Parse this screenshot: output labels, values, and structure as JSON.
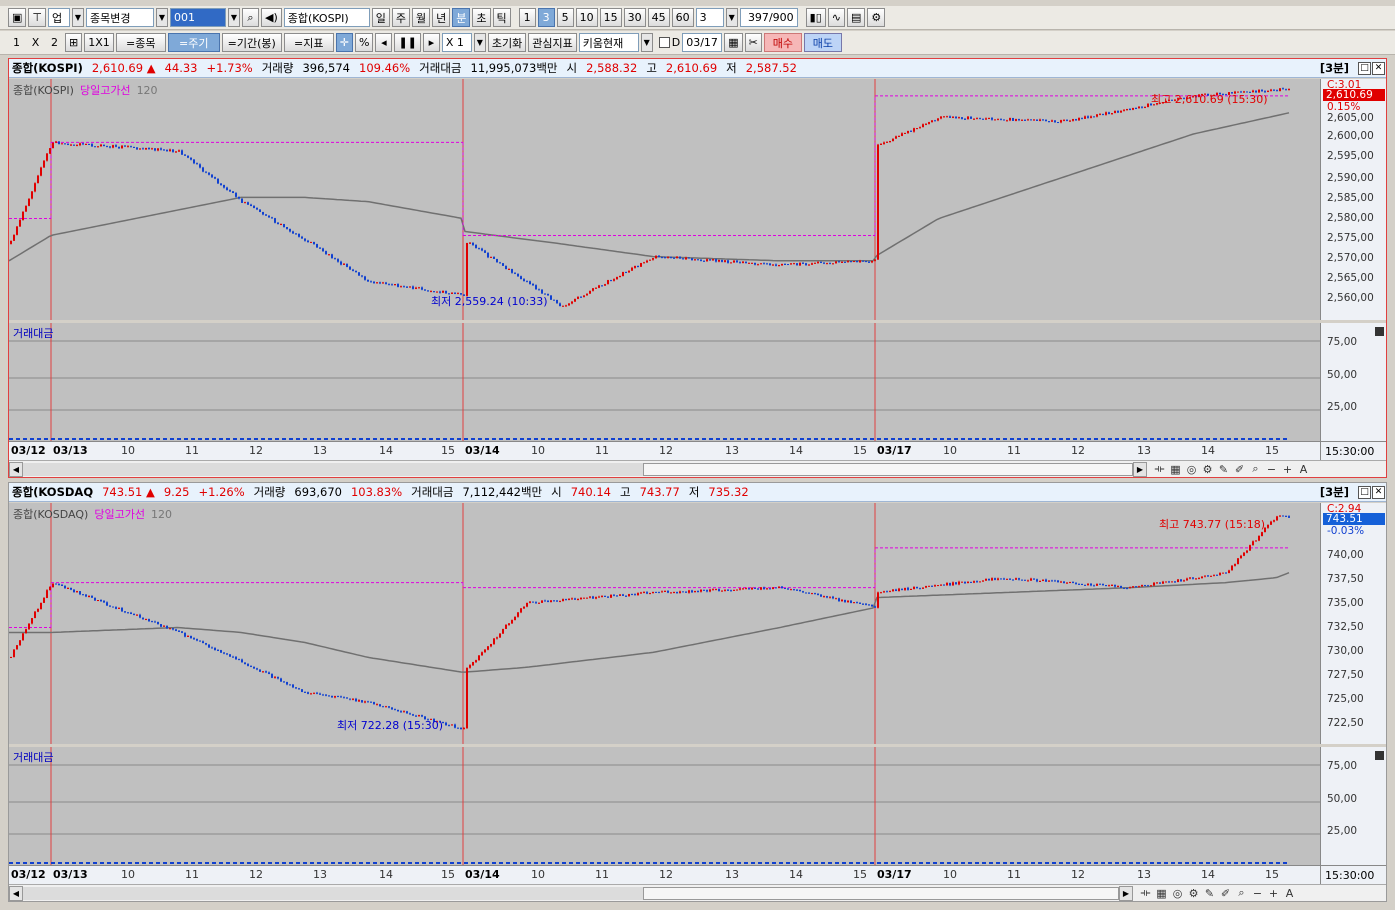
{
  "toolbar1": {
    "market_type": "업",
    "item_change_label": "종목변경",
    "code_value": "001",
    "index_name": "종합(KOSPI)",
    "period_buttons": [
      "일",
      "주",
      "월",
      "년",
      "분",
      "초",
      "틱"
    ],
    "selected_period": "분",
    "minute_buttons": [
      "1",
      "3",
      "5",
      "10",
      "15",
      "30",
      "45",
      "60"
    ],
    "selected_minute": "3",
    "interval_value": "3",
    "count_value": "397",
    "count_total": "/900"
  },
  "toolbar2": {
    "layout_labels": [
      "1",
      "X",
      "2"
    ],
    "grid_label": "1X1",
    "item_btn": "=종목",
    "period_btn": "=주기",
    "range_btn": "=기간(봉)",
    "indicator_btn": "=지표",
    "zoom_value": "X 1",
    "reset_btn": "초기화",
    "watch_btn": "관심지표",
    "theme_value": "키움현재",
    "checkbox_label": "D",
    "date_value": "03/17",
    "buy_label": "매수",
    "sell_label": "매도"
  },
  "panel_kospi": {
    "name": "종합(KOSPI)",
    "price": "2,610.69",
    "direction": "▲",
    "change": "44.33",
    "change_pct": "+1.73%",
    "volume_label": "거래량",
    "volume": "396,574",
    "volume_pct": "109.46%",
    "amount_label": "거래대금",
    "amount": "11,995,073백만",
    "open_label": "시",
    "open": "2,588.32",
    "high_label": "고",
    "high": "2,610.69",
    "low_label": "저",
    "low": "2,587.52",
    "period_label": "[3분]",
    "legend_main": "종합(KOSPI)",
    "legend_line": "당일고가선",
    "legend_ma": "120",
    "sub_legend": "거래대금",
    "price_ticks": [
      "2,605,00",
      "2,600,00",
      "2,595,00",
      "2,590,00",
      "2,585,00",
      "2,580,00",
      "2,575,00",
      "2,570,00",
      "2,565,00",
      "2,560,00"
    ],
    "current_tag": "2,610.69",
    "current_pct": "0.15%",
    "top_label": "C:3.01",
    "sub_ticks": [
      "75,00",
      "50,00",
      "25,00"
    ],
    "high_annot": "최고 2,610.69 (15:30)",
    "low_annot": "최저 2,559.24 (10:33)",
    "x_labels": [
      "03/12",
      "03/13",
      "10",
      "11",
      "12",
      "13",
      "14",
      "15",
      "03/14",
      "10",
      "11",
      "12",
      "13",
      "14",
      "15",
      "03/17",
      "10",
      "11",
      "12",
      "13",
      "14",
      "15"
    ],
    "time_label": "15:30:00",
    "colors": {
      "up": "#e00000",
      "down": "#1040d0",
      "ma": "#707070",
      "dayhigh": "#e000e0",
      "divider": "#e04040"
    }
  },
  "panel_kosdaq": {
    "name": "종합(KOSDAQ",
    "price": "743.51",
    "direction": "▲",
    "change": "9.25",
    "change_pct": "+1.26%",
    "volume_label": "거래량",
    "volume": "693,670",
    "volume_pct": "103.83%",
    "amount_label": "거래대금",
    "amount": "7,112,442백만",
    "open_label": "시",
    "open": "740.14",
    "high_label": "고",
    "high": "743.77",
    "low_label": "저",
    "low": "735.32",
    "period_label": "[3분]",
    "legend_main": "종합(KOSDAQ)",
    "legend_line": "당일고가선",
    "legend_ma": "120",
    "sub_legend": "거래대금",
    "price_ticks": [
      "740,00",
      "737,50",
      "735,00",
      "732,50",
      "730,00",
      "727,50",
      "725,00",
      "722,50"
    ],
    "current_tag": "743.51",
    "current_pct": "-0.03%",
    "top_label": "C:2.94",
    "sub_ticks": [
      "75,00",
      "50,00",
      "25,00"
    ],
    "high_annot": "최고 743.77 (15:18)",
    "low_annot": "최저 722.28 (15:30)",
    "x_labels": [
      "03/12",
      "03/13",
      "10",
      "11",
      "12",
      "13",
      "14",
      "15",
      "03/14",
      "10",
      "11",
      "12",
      "13",
      "14",
      "15",
      "03/17",
      "10",
      "11",
      "12",
      "13",
      "14",
      "15"
    ],
    "time_label": "15:30:00"
  },
  "chart_data": [
    {
      "type": "line",
      "title": "종합(KOSPI) 3분",
      "x": [
        "03/12 15:00",
        "03/13 09:00",
        "03/13 11:00",
        "03/13 12:00",
        "03/13 13:00",
        "03/13 14:00",
        "03/13 15:30",
        "03/14 09:00",
        "03/14 10:33",
        "03/14 12:00",
        "03/14 14:00",
        "03/14 15:30",
        "03/17 09:00",
        "03/17 10:00",
        "03/17 12:00",
        "03/17 14:00",
        "03/17 15:30"
      ],
      "series": [
        {
          "name": "종합(KOSPI)",
          "values": [
            2574,
            2598,
            2596,
            2584,
            2575,
            2565,
            2562,
            2575,
            2559.24,
            2571,
            2569,
            2570,
            2597,
            2604,
            2603,
            2609,
            2610.69
          ]
        },
        {
          "name": "120",
          "values": [
            2570,
            2576,
            2582,
            2585,
            2585,
            2584,
            2580,
            2577,
            2574,
            2571,
            2570,
            2570,
            2571,
            2580,
            2590,
            2600,
            2605
          ]
        }
      ],
      "ylim": [
        2556,
        2613
      ]
    },
    {
      "type": "line",
      "title": "종합(KOSDAQ) 3분",
      "x": [
        "03/12 15:00",
        "03/13 09:00",
        "03/13 11:00",
        "03/13 12:00",
        "03/13 13:00",
        "03/13 14:00",
        "03/13 15:30",
        "03/14 09:00",
        "03/14 10:00",
        "03/14 12:00",
        "03/14 14:00",
        "03/14 15:30",
        "03/17 09:00",
        "03/17 11:00",
        "03/17 13:00",
        "03/17 14:30",
        "03/17 15:18",
        "03/17 15:30"
      ],
      "series": [
        {
          "name": "종합(KOSDAQ)",
          "values": [
            729.5,
            737,
            732,
            729,
            726,
            725,
            722.28,
            728,
            735,
            736,
            736.5,
            734.5,
            736,
            737.5,
            736.5,
            738,
            743.77,
            743.51
          ]
        },
        {
          "name": "120",
          "values": [
            732,
            732,
            732.5,
            732,
            731,
            729.5,
            728,
            728,
            728.5,
            730,
            732.5,
            734.5,
            735.5,
            736,
            736.5,
            737,
            737.5,
            738
          ]
        }
      ],
      "ylim": [
        720.8,
        745
      ]
    }
  ]
}
